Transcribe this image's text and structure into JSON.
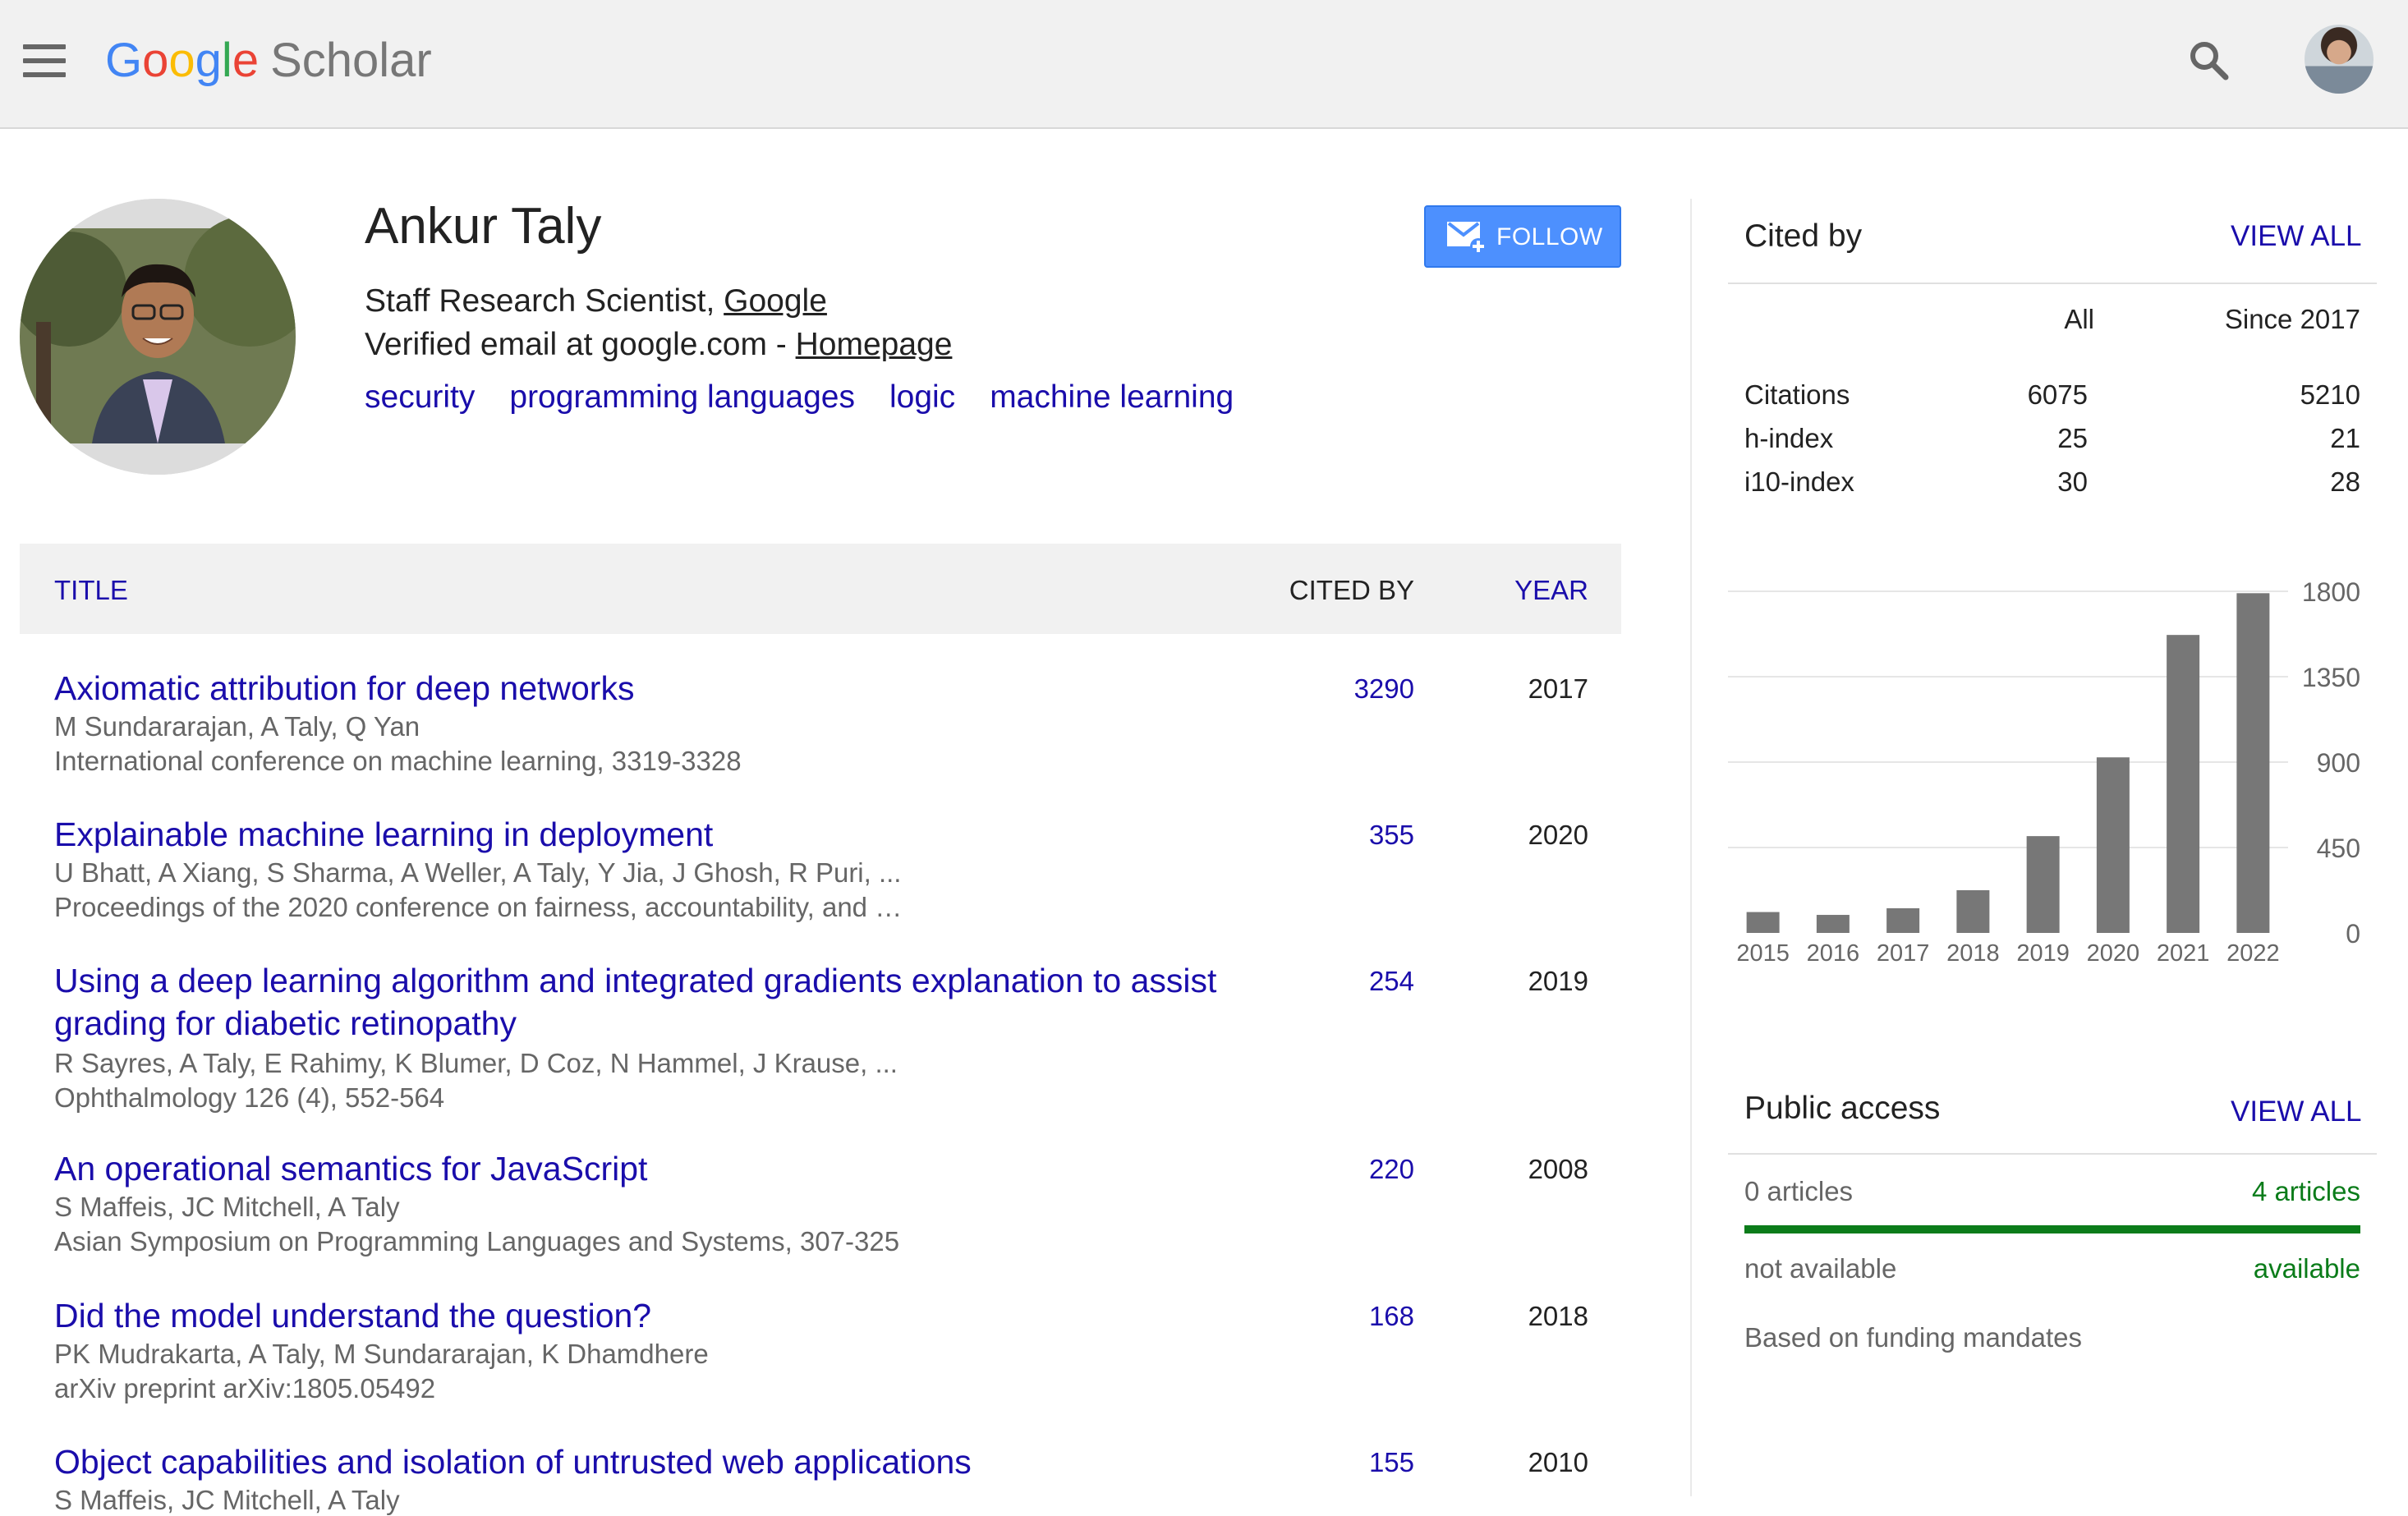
{
  "header": {
    "logo_letters": [
      "G",
      "o",
      "o",
      "g",
      "l",
      "e"
    ],
    "logo_suffix": "Scholar"
  },
  "profile": {
    "name": "Ankur Taly",
    "affiliation_prefix": "Staff Research Scientist, ",
    "affiliation_link": "Google",
    "email_prefix": "Verified email at google.com - ",
    "homepage_link": "Homepage",
    "interests": [
      "security",
      "programming languages",
      "logic",
      "machine learning"
    ],
    "follow_label": "FOLLOW"
  },
  "table": {
    "headers": {
      "title": "TITLE",
      "cited_by": "CITED BY",
      "year": "YEAR"
    },
    "rows": [
      {
        "title": "Axiomatic attribution for deep networks",
        "authors": "M Sundararajan, A Taly, Q Yan",
        "venue": "International conference on machine learning, 3319-3328",
        "cited_by": "3290",
        "year": "2017"
      },
      {
        "title": "Explainable machine learning in deployment",
        "authors": "U Bhatt, A Xiang, S Sharma, A Weller, A Taly, Y Jia, J Ghosh, R Puri, ...",
        "venue": "Proceedings of the 2020 conference on fairness, accountability, and …",
        "cited_by": "355",
        "year": "2020"
      },
      {
        "title": "Using a deep learning algorithm and integrated gradients explanation to assist grading for diabetic retinopathy",
        "authors": "R Sayres, A Taly, E Rahimy, K Blumer, D Coz, N Hammel, J Krause, ...",
        "venue": "Ophthalmology 126 (4), 552-564",
        "cited_by": "254",
        "year": "2019"
      },
      {
        "title": "An operational semantics for JavaScript",
        "authors": "S Maffeis, JC Mitchell, A Taly",
        "venue": "Asian Symposium on Programming Languages and Systems, 307-325",
        "cited_by": "220",
        "year": "2008"
      },
      {
        "title": "Did the model understand the question?",
        "authors": "PK Mudrakarta, A Taly, M Sundararajan, K Dhamdhere",
        "venue": "arXiv preprint arXiv:1805.05492",
        "cited_by": "168",
        "year": "2018"
      },
      {
        "title": "Object capabilities and isolation of untrusted web applications",
        "authors": "S Maffeis, JC Mitchell, A Taly",
        "venue": "",
        "cited_by": "155",
        "year": "2010"
      }
    ]
  },
  "cited_by": {
    "title": "Cited by",
    "view_all": "VIEW ALL",
    "col_all": "All",
    "col_since": "Since 2017",
    "stats": [
      {
        "label": "Citations",
        "all": "6075",
        "since": "5210"
      },
      {
        "label": "h-index",
        "all": "25",
        "since": "21"
      },
      {
        "label": "i10-index",
        "all": "30",
        "since": "28"
      }
    ]
  },
  "chart_data": {
    "type": "bar",
    "categories": [
      "2015",
      "2016",
      "2017",
      "2018",
      "2019",
      "2020",
      "2021",
      "2022"
    ],
    "values": [
      110,
      95,
      130,
      225,
      510,
      925,
      1570,
      1790
    ],
    "yticks": [
      0,
      450,
      900,
      1350,
      1800
    ],
    "ylim": [
      0,
      1800
    ],
    "bar_color": "#777777",
    "grid": true,
    "title": "",
    "xlabel": "",
    "ylabel": ""
  },
  "public_access": {
    "title": "Public access",
    "view_all": "VIEW ALL",
    "unavailable_count": "0 articles",
    "available_count": "4 articles",
    "unavailable_label": "not available",
    "available_label": "available",
    "available_fraction": 1.0,
    "note": "Based on funding mandates",
    "bar_color": "#0b7c1a"
  }
}
